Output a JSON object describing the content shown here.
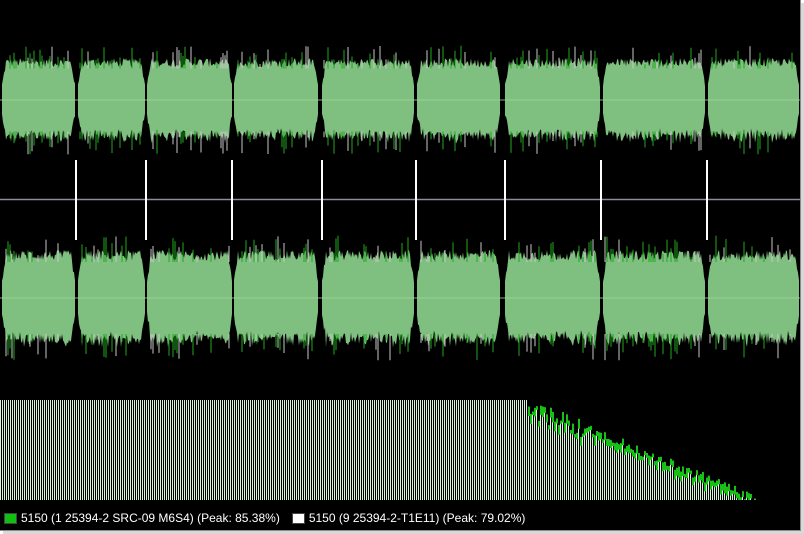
{
  "colors": {
    "background": "#000000",
    "waveform_fill": "#7fbf7f",
    "waveform_peak_a": "#1fa81f",
    "waveform_peak_b": "#c8c8c8",
    "centerline": "#9fd49f",
    "divider": "#8c8c9c",
    "track_marker": "#ffffff",
    "spectrum_fill": "#d8f5d8",
    "spectrum_edge": "#16c016",
    "series_a": "#10c010",
    "series_b": "#ffffff"
  },
  "legend": [
    {
      "id": "a",
      "label": "5150 (1 25394-2 SRC-09 M6S4) (Peak: 85.38%)",
      "color_key": "series_a"
    },
    {
      "id": "b",
      "label": "5150 (9 25394-2-T1E11) (Peak: 79.02%)",
      "color_key": "series_b"
    }
  ]
}
